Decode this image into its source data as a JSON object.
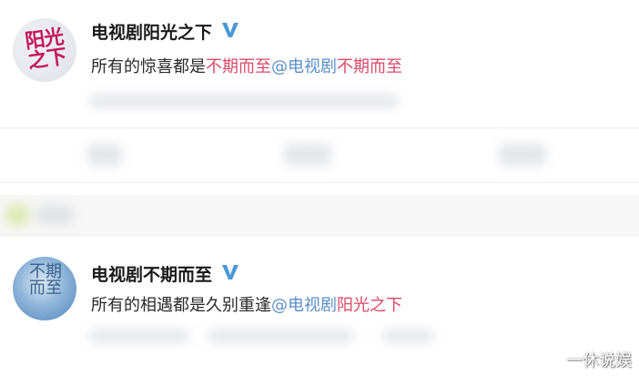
{
  "post1": {
    "avatar_text": "阳光之下",
    "username": "电视剧阳光之下",
    "verified_icon": "verified-v-icon",
    "content": {
      "prefix": "所有的惊喜都是",
      "highlight1": "不期而至",
      "mention": "@电视剧",
      "highlight2": "不期而至"
    }
  },
  "post2": {
    "avatar_text": "不期而至",
    "username": "电视剧不期而至",
    "verified_icon": "verified-v-icon",
    "content": {
      "prefix": "所有的相遇都是久别重逢",
      "mention": "@电视剧",
      "highlight": "阳光之下"
    }
  },
  "watermark": "一休说娱",
  "colors": {
    "highlight_red": "#d94a6a",
    "mention_blue": "#5b8fc7",
    "verified_blue": "#4a98d6"
  }
}
